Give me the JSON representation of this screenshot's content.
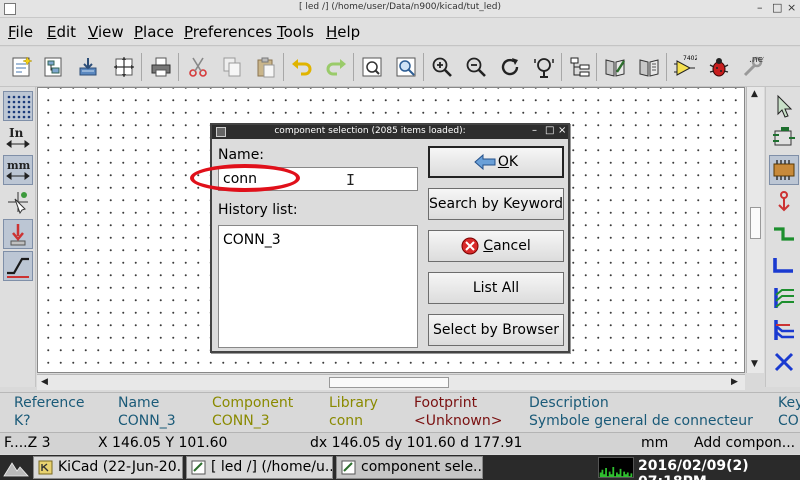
{
  "window": {
    "title": "[ led /] (/home/user/Data/n900/kicad/tut_led)",
    "controls": [
      "–",
      "□",
      "×"
    ]
  },
  "menu": [
    {
      "label": "File",
      "accel": "F",
      "rest": "ile"
    },
    {
      "label": "Edit",
      "accel": "E",
      "rest": "dit"
    },
    {
      "label": "View",
      "accel": "V",
      "rest": "iew"
    },
    {
      "label": "Place",
      "accel": "P",
      "rest": "lace"
    },
    {
      "label": "Preferences",
      "accel": "P",
      "rest": "references"
    },
    {
      "label": "Tools",
      "accel": "T",
      "rest": "ools"
    },
    {
      "label": "Help",
      "accel": "H",
      "rest": "elp"
    }
  ],
  "toolbar": {
    "icons": [
      "new-sheet-icon",
      "hierarchy-icon",
      "save-icon",
      "page-settings-icon",
      "print-icon",
      "cut-icon",
      "copy-icon",
      "paste-icon",
      "undo-icon",
      "redo-icon",
      "find-icon",
      "find-replace-icon",
      "zoom-in-icon",
      "zoom-out-icon",
      "redraw-icon",
      "zoom-fit-icon",
      "navigator-icon",
      "library-editor-icon",
      "library-browser-icon",
      "netlist-icon",
      "erc-icon",
      "cvpcb-icon",
      "pcbnew-icon"
    ],
    "netlist_badge": "7402",
    "pcbnew_label": ".net"
  },
  "left_toolbar": {
    "inch_label": "In",
    "mm_label": "mm"
  },
  "dialog": {
    "title": "component selection (2085 items loaded):",
    "controls": [
      "–",
      "□",
      "×"
    ],
    "name_label": "Name:",
    "name_value": "conn",
    "history_label": "History list:",
    "history_items": [
      "CONN_3"
    ],
    "ok_label": "OK",
    "ok_accel": "O",
    "ok_rest": "K",
    "search_keyword_label": "Search by Keyword",
    "cancel_label": "Cancel",
    "cancel_accel": "C",
    "cancel_rest": "ancel",
    "list_all_label": "List All",
    "browser_label": "Select by Browser"
  },
  "info_panel": {
    "reference": {
      "header": "Reference",
      "value": "K?"
    },
    "name": {
      "header": "Name",
      "value": "CONN_3"
    },
    "component": {
      "header": "Component",
      "value": "CONN_3"
    },
    "library": {
      "header": "Library",
      "value": "conn"
    },
    "footprint": {
      "header": "Footprint",
      "value": "<Unknown>"
    },
    "description": {
      "header": "Description",
      "value": "Symbole general de connecteur"
    },
    "keywords": {
      "header": "Key",
      "value": "CO"
    },
    "colors": {
      "reference": "#1a5a78",
      "name": "#1a5a78",
      "component": "#8a8a00",
      "library": "#8a8a00",
      "footprint": "#7a1010",
      "description": "#1a5a78",
      "keywords": "#1a5a78"
    }
  },
  "status": {
    "zoom": "F....Z 3",
    "xy": "X 146.05  Y 101.60",
    "delta": "dx 146.05  dy 101.60  d 177.91",
    "units": "mm",
    "action": "Add compon..."
  },
  "taskbar": {
    "tasks": [
      "KiCad (22-Jun-20...",
      "[ led /] (/home/u...",
      "component sele..."
    ],
    "clock": "2016/02/09(2) 07:18PM"
  }
}
